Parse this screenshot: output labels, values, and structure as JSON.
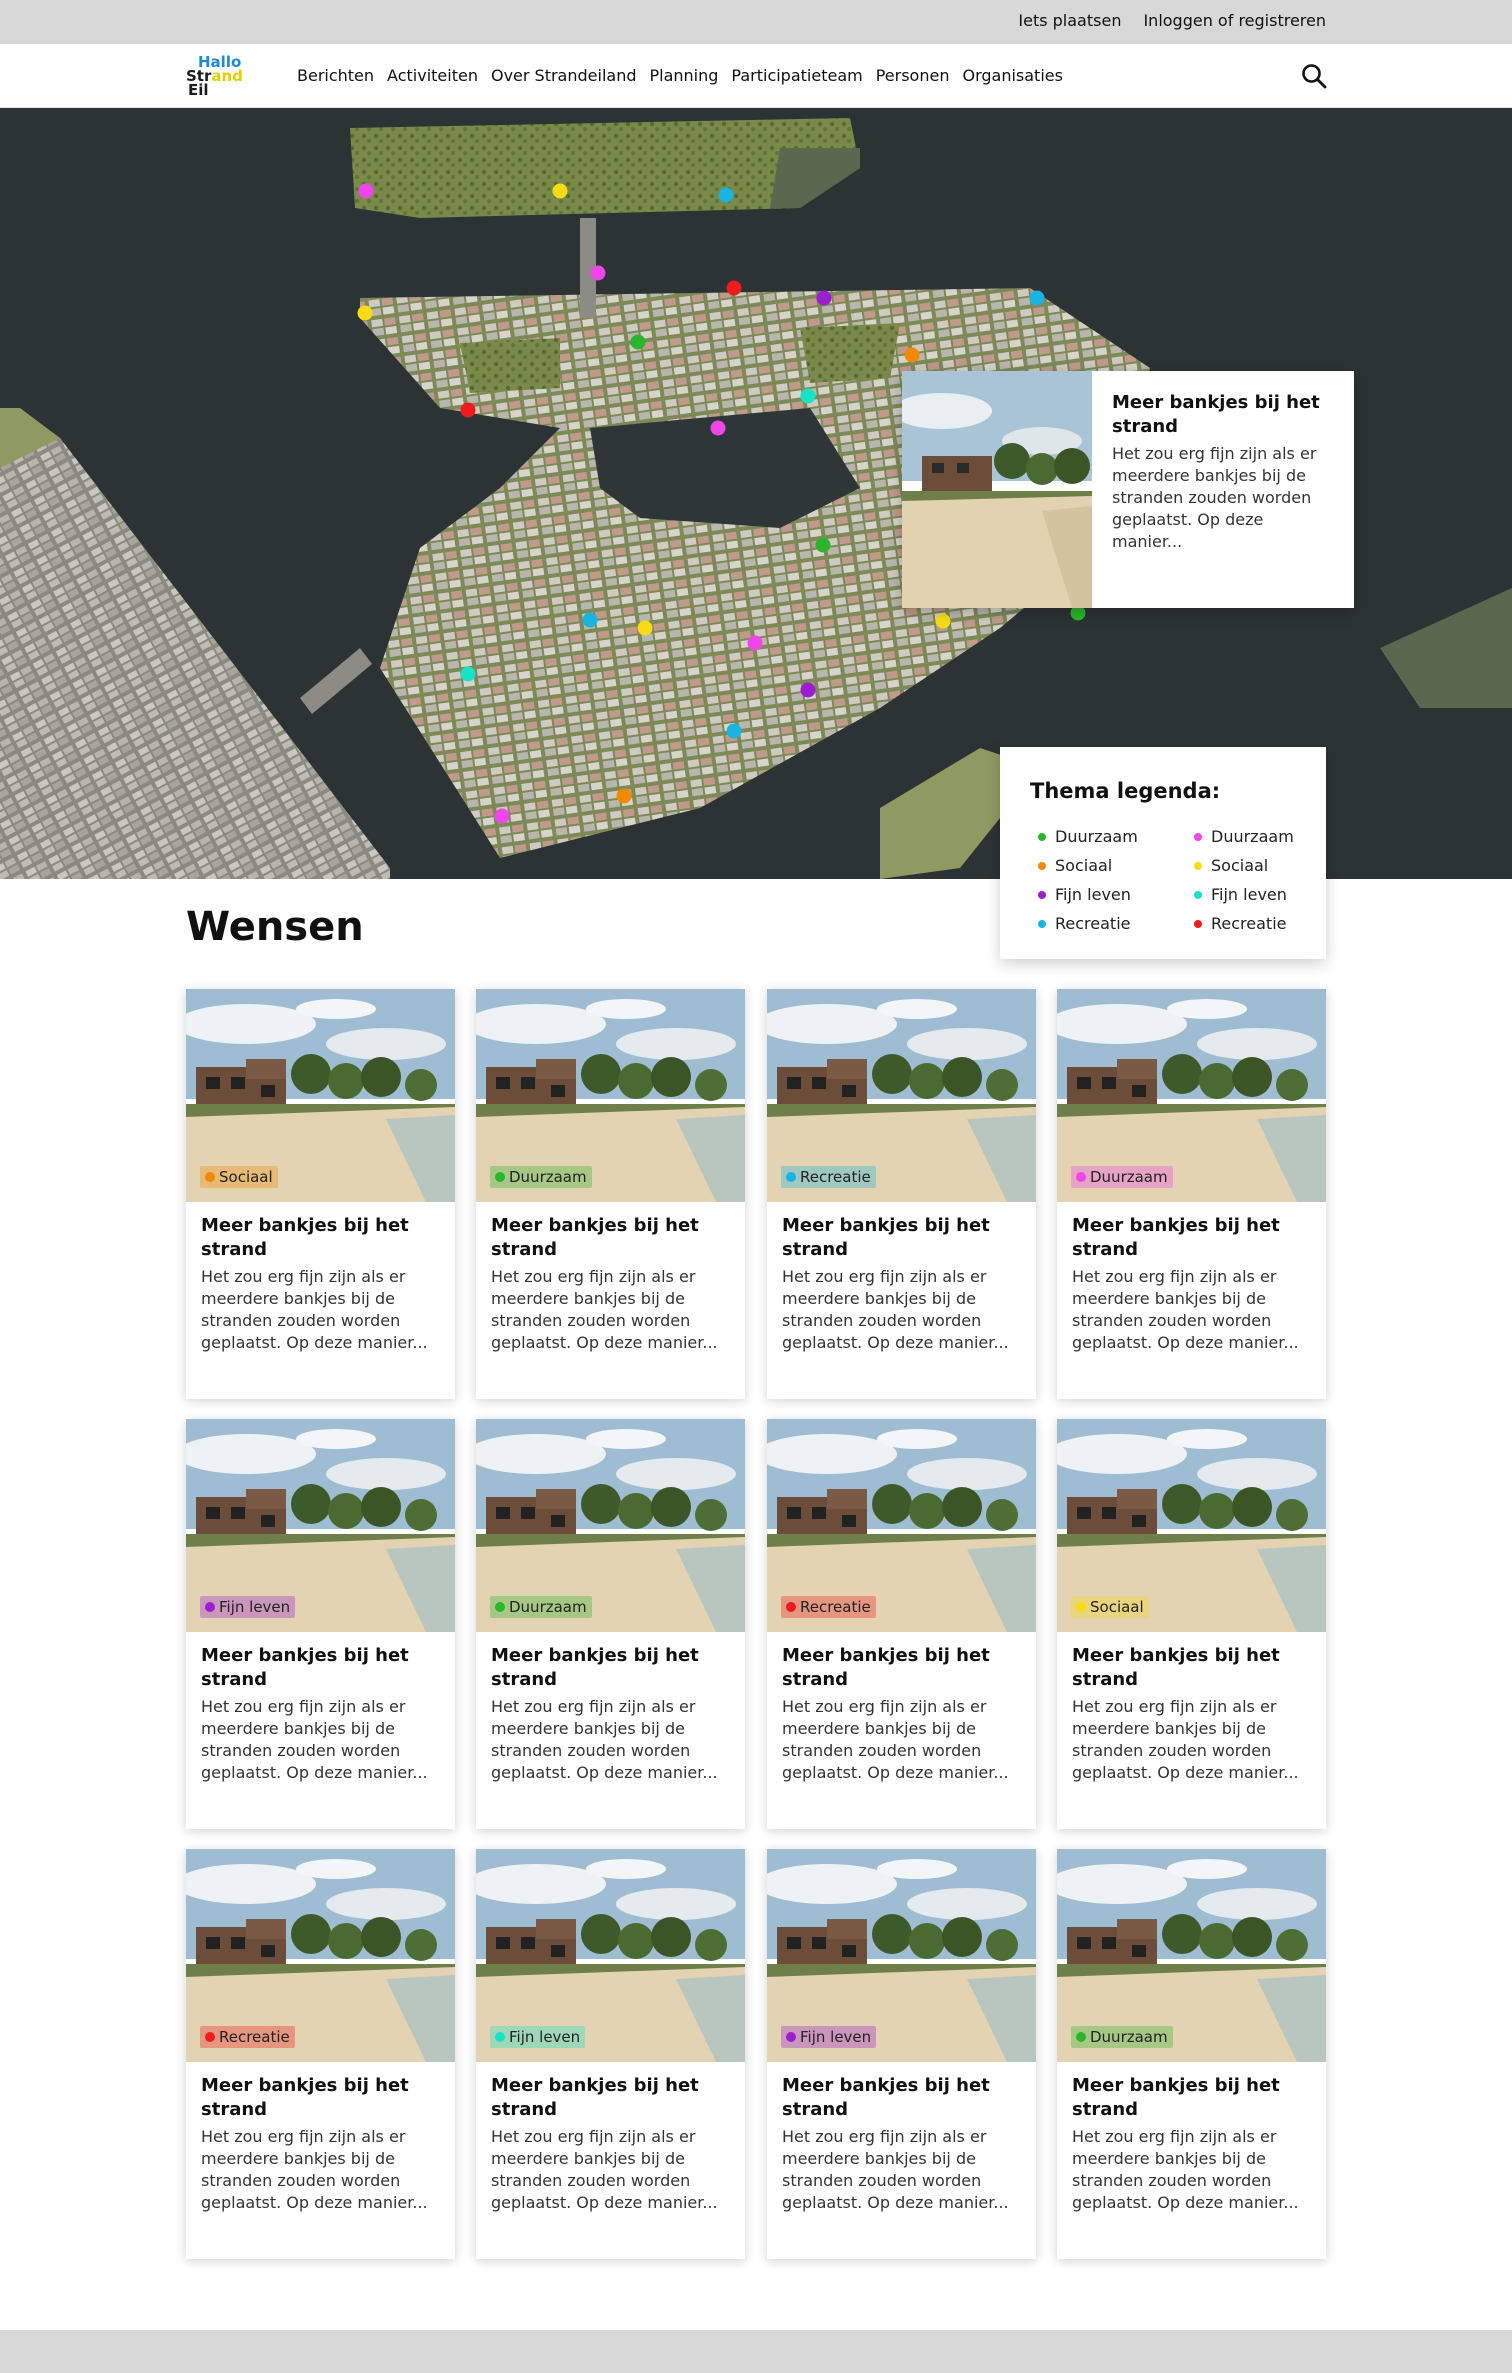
{
  "topbar": {
    "post_link": "Iets plaatsen",
    "login_link": "Inloggen of registreren"
  },
  "logo": {
    "line1": "Hallo",
    "line2a": "Str",
    "line2b": "and",
    "line3": "Eil"
  },
  "nav": {
    "items": [
      "Berichten",
      "Activiteiten",
      "Over Strandeiland",
      "Planning",
      "Participatieteam",
      "Personen",
      "Organisaties"
    ],
    "search_icon": "search-icon"
  },
  "colors": {
    "green": "#2cb52c",
    "orange": "#f08a00",
    "purple": "#9b1fcf",
    "cyan": "#19b4e2",
    "pink": "#ef46ec",
    "yellow": "#f7dc15",
    "teal": "#19e3c5",
    "red": "#ee1c1c"
  },
  "map_pins": [
    {
      "color": "pink"
    },
    {
      "color": "yellow"
    },
    {
      "color": "cyan"
    },
    {
      "color": "pink"
    },
    {
      "color": "yellow"
    },
    {
      "color": "red"
    },
    {
      "color": "purple"
    },
    {
      "color": "cyan"
    },
    {
      "color": "green"
    },
    {
      "color": "orange"
    },
    {
      "color": "teal"
    },
    {
      "color": "red"
    },
    {
      "color": "pink"
    },
    {
      "color": "green"
    },
    {
      "color": "cyan"
    },
    {
      "color": "yellow"
    },
    {
      "color": "pink"
    },
    {
      "color": "teal"
    },
    {
      "color": "purple"
    },
    {
      "color": "cyan"
    },
    {
      "color": "orange"
    },
    {
      "color": "pink"
    },
    {
      "color": "yellow"
    },
    {
      "color": "green"
    }
  ],
  "popup": {
    "title": "Meer bankjes bij het strand",
    "description": "Het zou erg fijn zijn als er meerdere bankjes bij de stranden zouden worden geplaatst. Op deze manier..."
  },
  "legend": {
    "title": "Thema legenda:",
    "col1": [
      {
        "label": "Duurzaam",
        "color": "green"
      },
      {
        "label": "Sociaal",
        "color": "orange"
      },
      {
        "label": "Fijn leven",
        "color": "purple"
      },
      {
        "label": "Recreatie",
        "color": "cyan"
      }
    ],
    "col2": [
      {
        "label": "Duurzaam",
        "color": "pink"
      },
      {
        "label": "Sociaal",
        "color": "yellow"
      },
      {
        "label": "Fijn leven",
        "color": "teal"
      },
      {
        "label": "Recreatie",
        "color": "red"
      }
    ]
  },
  "wensen": {
    "title": "Wensen",
    "cards": [
      {
        "tag": "Sociaal",
        "color": "orange",
        "title": "Meer bankjes bij het strand",
        "description": "Het zou erg fijn zijn als er meerdere bankjes bij de stranden zouden worden geplaatst. Op deze manier..."
      },
      {
        "tag": "Duurzaam",
        "color": "green",
        "title": "Meer bankjes bij het strand",
        "description": "Het zou erg fijn zijn als er meerdere bankjes bij de stranden zouden worden geplaatst. Op deze manier..."
      },
      {
        "tag": "Recreatie",
        "color": "cyan",
        "title": "Meer bankjes bij het strand",
        "description": "Het zou erg fijn zijn als er meerdere bankjes bij de stranden zouden worden geplaatst. Op deze manier..."
      },
      {
        "tag": "Duurzaam",
        "color": "pink",
        "title": "Meer bankjes bij het strand",
        "description": "Het zou erg fijn zijn als er meerdere bankjes bij de stranden zouden worden geplaatst. Op deze manier..."
      },
      {
        "tag": "Fijn leven",
        "color": "purple",
        "title": "Meer bankjes bij het strand",
        "description": "Het zou erg fijn zijn als er meerdere bankjes bij de stranden zouden worden geplaatst. Op deze manier..."
      },
      {
        "tag": "Duurzaam",
        "color": "green",
        "title": "Meer bankjes bij het strand",
        "description": "Het zou erg fijn zijn als er meerdere bankjes bij de stranden zouden worden geplaatst. Op deze manier..."
      },
      {
        "tag": "Recreatie",
        "color": "red",
        "title": "Meer bankjes bij het strand",
        "description": "Het zou erg fijn zijn als er meerdere bankjes bij de stranden zouden worden geplaatst. Op deze manier..."
      },
      {
        "tag": "Sociaal",
        "color": "yellow",
        "title": "Meer bankjes bij het strand",
        "description": "Het zou erg fijn zijn als er meerdere bankjes bij de stranden zouden worden geplaatst. Op deze manier..."
      },
      {
        "tag": "Recreatie",
        "color": "red",
        "title": "Meer bankjes bij het strand",
        "description": "Het zou erg fijn zijn als er meerdere bankjes bij de stranden zouden worden geplaatst. Op deze manier..."
      },
      {
        "tag": "Fijn leven",
        "color": "teal",
        "title": "Meer bankjes bij het strand",
        "description": "Het zou erg fijn zijn als er meerdere bankjes bij de stranden zouden worden geplaatst. Op deze manier..."
      },
      {
        "tag": "Fijn leven",
        "color": "purple",
        "title": "Meer bankjes bij het strand",
        "description": "Het zou erg fijn zijn als er meerdere bankjes bij de stranden zouden worden geplaatst. Op deze manier..."
      },
      {
        "tag": "Duurzaam",
        "color": "green",
        "title": "Meer bankjes bij het strand",
        "description": "Het zou erg fijn zijn als er meerdere bankjes bij de stranden zouden worden geplaatst. Op deze manier..."
      }
    ]
  }
}
